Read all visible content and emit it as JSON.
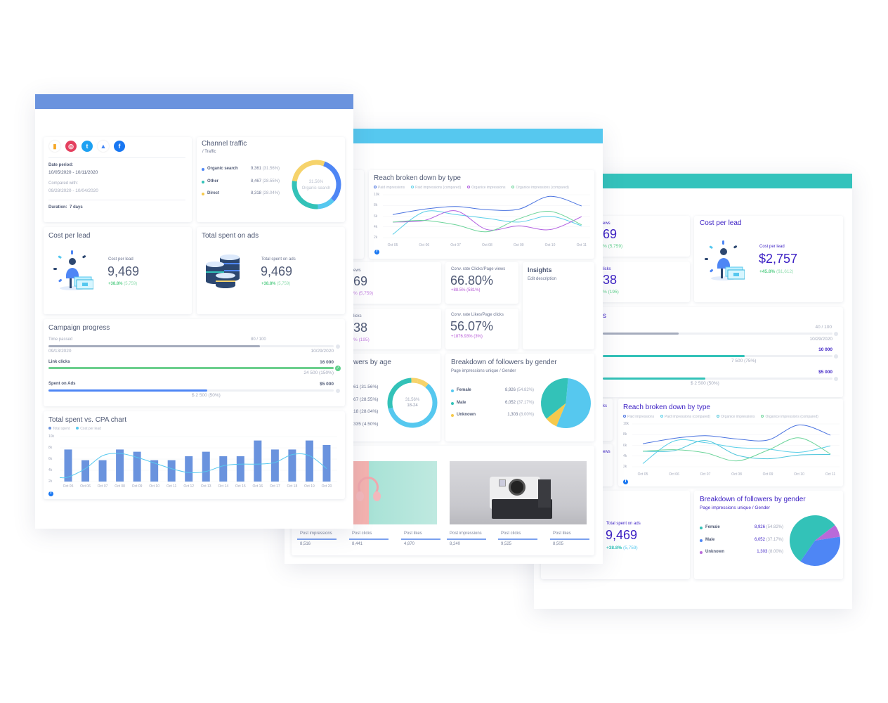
{
  "colors": {
    "front_header": "#6a93de",
    "middle_header": "#56c8ef",
    "back_header": "#34c3bc",
    "back_title": "#3b1fc4",
    "green": "#5ccf8a",
    "purple": "#b65ad6",
    "blue": "#4e86f5",
    "teal": "#33c2b8",
    "yellow": "#f6c94c",
    "cyan": "#56c8ef"
  },
  "front": {
    "icons": [
      "analytics-icon",
      "instagram-icon",
      "twitter-icon",
      "google-ads-icon",
      "facebook-icon"
    ],
    "date_period_label": "Date period:",
    "date_period": "10/05/2020 - 10/11/2020",
    "compared_label": "Compared with:",
    "compared": "09/28/2020 - 10/04/2020",
    "duration_label": "Duration:",
    "duration": "7 days",
    "channel": {
      "title": "Channel traffic",
      "subtitle": "/ Traffic",
      "rows": [
        {
          "label": "Organic search",
          "value": "9,361",
          "pct": "(31.56%)"
        },
        {
          "label": "Other",
          "value": "8,467",
          "pct": "(28.55%)"
        },
        {
          "label": "Direct",
          "value": "8,318",
          "pct": "(28.04%)"
        }
      ],
      "center_pct": "31.56%",
      "center_label": "Organic search"
    },
    "cpl": {
      "title": "Cost per lead",
      "label": "Cost per lead",
      "value": "9,469",
      "delta": "+38.8%",
      "prev": "(5,759)"
    },
    "spent": {
      "title": "Total spent on ads",
      "label": "Total spent on ads",
      "value": "9,469",
      "delta": "+38.8%",
      "prev": "(5,759)"
    },
    "campaign": {
      "title": "Campaign progress",
      "time_label": "Time passed",
      "time_value": "80 / 100",
      "time_progress": 0.8,
      "start": "09/13/2020",
      "end": "10/29/2020",
      "clicks_label": "Link clicks",
      "clicks_goal": "16 000",
      "clicks_actual": "24 500 (150%)",
      "clicks_progress": 1.5,
      "ads_label": "Spent on Ads",
      "ads_goal": "$5 000",
      "ads_actual": "$ 2 500 (50%)",
      "ads_progress": 0.5
    }
  },
  "middle": {
    "reach_title": "Reach broken down by type",
    "frag1": {
      "label": "ews",
      "value": "69",
      "delta": "% (5,759)"
    },
    "frag2": {
      "label": "licks",
      "value": "38",
      "delta": "% (195)"
    },
    "conv1": {
      "label": "Conv. rate Clicks/Page views",
      "value": "66.80%",
      "delta": "+88.5% (581%)"
    },
    "conv2": {
      "label": "Conv. rate Likes/Page clicks",
      "value": "56.07%",
      "delta": "+1876.93% (3%)"
    },
    "insights": {
      "title": "Insights",
      "desc": "Edit description"
    },
    "age": {
      "title": "wers by age",
      "rows": [
        "61 (31.56%)",
        "67 (28.55%)",
        "18 (28.04%)",
        "335 (4.50%)"
      ],
      "center_pct": "31.56%",
      "center_label": "18-24"
    },
    "gender": {
      "title": "Breakdown of followers by gender",
      "subtitle": "Page impressions unique / Gender",
      "rows": [
        {
          "label": "Female",
          "value": "8,926",
          "pct": "(54.82%)"
        },
        {
          "label": "Male",
          "value": "6,052",
          "pct": "(37.17%)"
        },
        {
          "label": "Unknown",
          "value": "1,303",
          "pct": "(8.00%)"
        }
      ]
    },
    "posts": [
      {
        "label": "Post impressions",
        "value": "8,516"
      },
      {
        "label": "Post clicks",
        "value": "8,441"
      },
      {
        "label": "Post likes",
        "value": "4,870"
      },
      {
        "label": "Post impressions",
        "value": "8,240"
      },
      {
        "label": "Post clicks",
        "value": "9,525"
      },
      {
        "label": "Post likes",
        "value": "8,505"
      }
    ]
  },
  "back": {
    "frag1": {
      "label": "ews",
      "value": "69",
      "delta": "% (5,759)"
    },
    "frag2": {
      "label": "licks",
      "value": "38",
      "delta": "% (195)"
    },
    "frag3": "ks",
    "frag4": "ews",
    "frag5": "s",
    "cpl": {
      "title": "Cost per lead",
      "label": "Cost per lead",
      "value": "$2,757",
      "delta": "+45.8%",
      "prev": "($1,612)"
    },
    "campaign": {
      "time_value": "40 / 100",
      "time_progress": 0.4,
      "end": "10/29/2020",
      "clicks_goal": "10 000",
      "clicks_actual": "7 500 (75%)",
      "clicks_progress": 0.75,
      "ads_goal": "$5 000",
      "ads_actual": "$ 2 500 (50%)",
      "ads_progress": 0.5
    },
    "reach_title": "Reach broken down by type",
    "spent": {
      "label": "Total spent on ads",
      "value": "9,469",
      "delta": "+38.8%",
      "prev": "(5,759)"
    },
    "gender": {
      "title": "Breakdown of followers by gender",
      "subtitle": "Page impressions unique / Gender",
      "rows": [
        {
          "label": "Female",
          "value": "8,926",
          "pct": "(54.82%)"
        },
        {
          "label": "Male",
          "value": "6,052",
          "pct": "(37.17%)"
        },
        {
          "label": "Unknown",
          "value": "1,303",
          "pct": "(8.00%)"
        }
      ]
    }
  },
  "chart_data": [
    {
      "type": "bar",
      "title": "Total spent vs. CPA chart",
      "categories": [
        "Oct 05",
        "Oct 06",
        "Oct 07",
        "Oct 08",
        "Oct 09",
        "Oct 10",
        "Oct 11",
        "Oct 12",
        "Oct 13",
        "Oct 14",
        "Oct 15",
        "Oct 16",
        "Oct 17",
        "Oct 18",
        "Oct 19",
        "Oct 20"
      ],
      "yticks": [
        "10k",
        "8k",
        "6k",
        "4k",
        "2k"
      ],
      "ylim": [
        2000,
        10000
      ],
      "legend": "top-left",
      "series": [
        {
          "name": "Total spent",
          "kind": "bar",
          "color": "#6a93de",
          "values": [
            7700,
            5800,
            5800,
            7700,
            7300,
            5800,
            5800,
            6500,
            7300,
            6500,
            6500,
            9300,
            7700,
            7700,
            9300,
            8500
          ]
        },
        {
          "name": "Cost per lead",
          "kind": "line",
          "color": "#56c8ef",
          "values": [
            2800,
            4300,
            6600,
            7000,
            6300,
            5300,
            4300,
            3600,
            3800,
            4800,
            5100,
            5100,
            5400,
            6800,
            6600,
            4300
          ]
        }
      ]
    },
    {
      "type": "line",
      "title": "Reach broken down by type",
      "categories": [
        "Oct 05",
        "Oct 06",
        "Oct 07",
        "Oct 08",
        "Oct 09",
        "Oct 10",
        "Oct 11"
      ],
      "yticks": [
        "10k",
        "8k",
        "6k",
        "4k",
        "2k"
      ],
      "ylim": [
        2000,
        10000
      ],
      "legend": "top",
      "series": [
        {
          "name": "Paid impressions",
          "color": "#4a73e0",
          "values": [
            6300,
            7300,
            7800,
            7200,
            7300,
            9700,
            7900
          ]
        },
        {
          "name": "Paid impressions (compared)",
          "color": "#5bcfe8",
          "values": [
            2600,
            6800,
            6300,
            5600,
            4900,
            6000,
            4200
          ]
        },
        {
          "name": "Organice impressions",
          "color": "#b05ce0",
          "values": [
            4900,
            5200,
            7000,
            3500,
            4200,
            3500,
            5900
          ]
        },
        {
          "name": "Organice impressions (compared)",
          "color": "#6cd49a",
          "values": [
            4900,
            5200,
            4400,
            3100,
            5500,
            6900,
            4400
          ]
        }
      ]
    },
    {
      "type": "line",
      "title": "Reach broken down by type",
      "categories": [
        "Oct 05",
        "Oct 06",
        "Oct 07",
        "Oct 08",
        "Oct 09",
        "Oct 10",
        "Oct 11"
      ],
      "yticks": [
        "10k",
        "8k",
        "6k",
        "4k",
        "2k"
      ],
      "ylim": [
        2000,
        10000
      ],
      "legend": "top",
      "series": [
        {
          "name": "Paid impressions",
          "color": "#4a73e0",
          "values": [
            6300,
            7300,
            7800,
            7200,
            7000,
            9800,
            7900
          ]
        },
        {
          "name": "Paid impressions (compared)",
          "color": "#5bcfe8",
          "values": [
            2600,
            6800,
            6500,
            5600,
            5300,
            4700,
            5900
          ]
        },
        {
          "name": "Organice impressions",
          "color": "#4fc6dc",
          "values": [
            4900,
            5000,
            6900,
            4200,
            3500,
            4200,
            4300
          ]
        },
        {
          "name": "Organice impressions (compared)",
          "color": "#6cd49a",
          "values": [
            4900,
            5200,
            4600,
            3100,
            5100,
            7400,
            4400
          ]
        }
      ]
    },
    {
      "type": "pie",
      "donut": true,
      "title": "Channel traffic",
      "start_deg": 20,
      "slices": [
        {
          "label": "Organic search",
          "value": 31.56,
          "color": "#4e86f5"
        },
        {
          "label": "",
          "value": 11.85,
          "color": "#56c8ef"
        },
        {
          "label": "Other",
          "value": 28.55,
          "color": "#33c2b8"
        },
        {
          "label": "Direct",
          "value": 28.04,
          "color": "#f6d36b"
        }
      ]
    },
    {
      "type": "pie",
      "donut": true,
      "title": "wers by age",
      "start_deg": 40,
      "slices": [
        {
          "label": "18-24",
          "value": 31.56,
          "color": "#56c8ef"
        },
        {
          "label": "",
          "value": 28.55,
          "color": "#56c8ef"
        },
        {
          "label": "",
          "value": 28.04,
          "color": "#33c2b8"
        },
        {
          "label": "",
          "value": 4.5,
          "color": "#f6d36b"
        },
        {
          "label": "",
          "value": 7.35,
          "color": "#f6d36b"
        }
      ]
    },
    {
      "type": "pie",
      "title": "Breakdown of followers by gender",
      "start_deg": 5,
      "slices": [
        {
          "label": "Female",
          "value": 54.82,
          "color": "#56c8ef"
        },
        {
          "label": "Unknown",
          "value": 8.0,
          "color": "#f6c94c"
        },
        {
          "label": "Male",
          "value": 37.17,
          "color": "#33c2b8"
        }
      ]
    },
    {
      "type": "pie",
      "title": "Breakdown of followers by gender",
      "start_deg": 215,
      "slices": [
        {
          "label": "Female",
          "value": 54.82,
          "color": "#33c2b8"
        },
        {
          "label": "Unknown",
          "value": 8.0,
          "color": "#b96ad9"
        },
        {
          "label": "Male",
          "value": 37.17,
          "color": "#4e86f5"
        }
      ]
    }
  ]
}
